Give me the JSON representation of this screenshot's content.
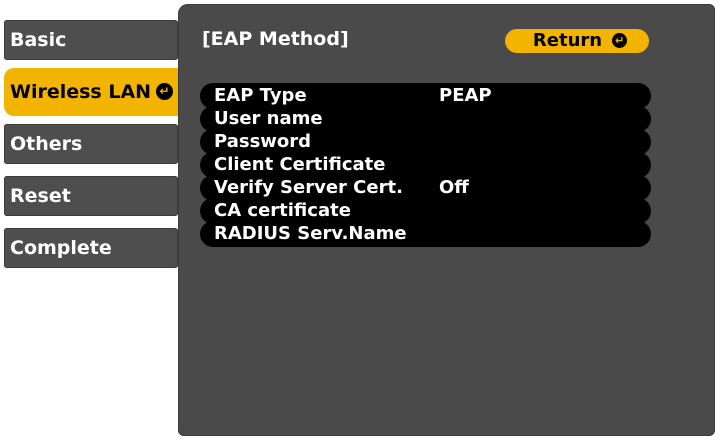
{
  "sidebar": {
    "items": [
      {
        "label": "Basic"
      },
      {
        "label": "Wireless LAN"
      },
      {
        "label": "Others"
      },
      {
        "label": "Reset"
      },
      {
        "label": "Complete"
      }
    ]
  },
  "panel": {
    "title": "[EAP Method]",
    "return_label": "Return",
    "rows": [
      {
        "label": "EAP Type",
        "value": "PEAP"
      },
      {
        "label": "User name",
        "value": ""
      },
      {
        "label": "Password",
        "value": ""
      },
      {
        "label": "Client Certificate",
        "value": ""
      },
      {
        "label": "Verify Server Cert.",
        "value": "Off"
      },
      {
        "label": "CA certificate",
        "value": ""
      },
      {
        "label": "RADIUS Serv.Name",
        "value": ""
      }
    ]
  },
  "colors": {
    "accent": "#f3b400",
    "panel": "#4a4a4a",
    "row": "#000000",
    "menu_item": "#4e4e4e"
  },
  "icons": {
    "enter": "enter-icon"
  }
}
